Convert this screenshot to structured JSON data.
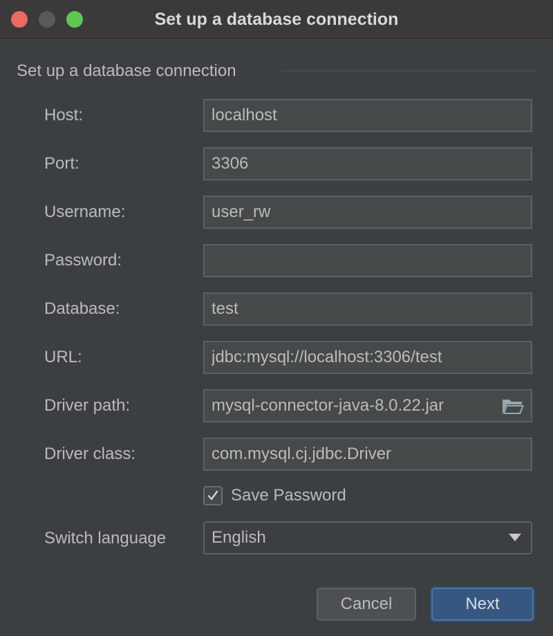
{
  "window": {
    "title": "Set up a database connection"
  },
  "section": {
    "title": "Set up a database connection"
  },
  "form": {
    "host": {
      "label": "Host:",
      "value": "localhost"
    },
    "port": {
      "label": "Port:",
      "value": "3306"
    },
    "username": {
      "label": "Username:",
      "value": "user_rw"
    },
    "password": {
      "label": "Password:",
      "value": ""
    },
    "database": {
      "label": "Database:",
      "value": "test"
    },
    "url": {
      "label": "URL:",
      "value": "jdbc:mysql://localhost:3306/test"
    },
    "driver_path": {
      "label": "Driver path:",
      "value": "mysql-connector-java-8.0.22.jar",
      "icon": "folder-open-icon"
    },
    "driver_class": {
      "label": "Driver class:",
      "value": "com.mysql.cj.jdbc.Driver"
    },
    "save_password": {
      "label": "Save Password",
      "checked": true
    },
    "language": {
      "label": "Switch language",
      "selected": "English"
    }
  },
  "buttons": {
    "cancel": "Cancel",
    "next": "Next"
  },
  "colors": {
    "background": "#3c3f41",
    "field_background": "#45494a",
    "field_border": "#5e6060",
    "text": "#bbbbbb",
    "primary_button": "#365880",
    "traffic_close": "#ed6a5e",
    "traffic_minimize": "#595959",
    "traffic_zoom": "#61c554"
  }
}
